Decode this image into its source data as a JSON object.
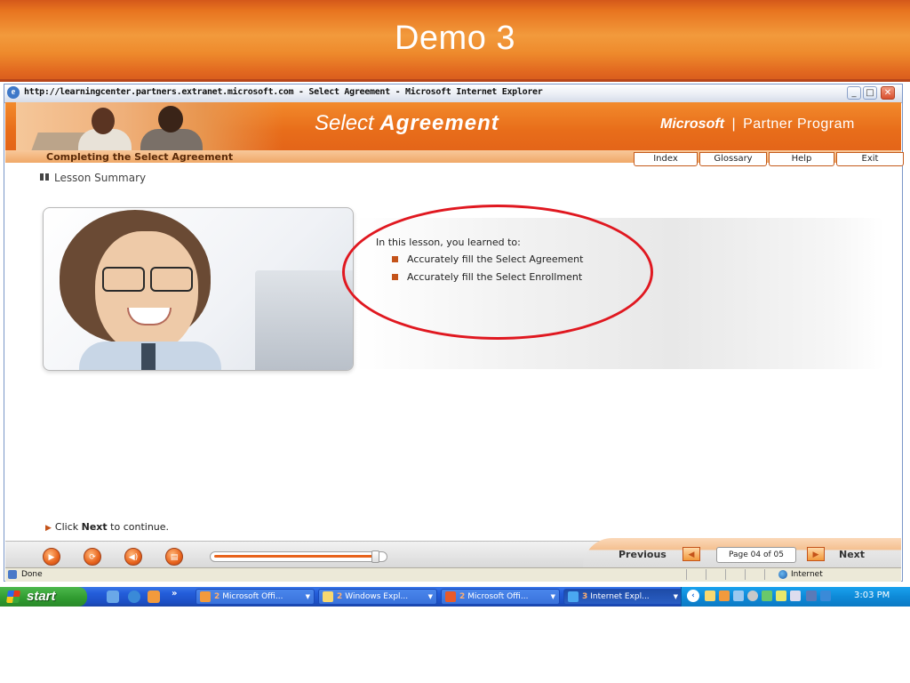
{
  "slide": {
    "title": "Demo 3"
  },
  "browser": {
    "title": "http://learningcenter.partners.extranet.microsoft.com - Select Agreement - Microsoft Internet Explorer",
    "status_text": "Done",
    "zone": "Internet"
  },
  "course": {
    "title_light": "Select",
    "title_bold": "Agreement",
    "brand_ms": "Microsoft",
    "brand_sep": "|",
    "brand_program": "Partner Program",
    "section": "Completing the Select Agreement",
    "nav": [
      "Index",
      "Glossary",
      "Help",
      "Exit"
    ],
    "lesson_heading": "Lesson Summary",
    "summary_intro": "In this lesson, you learned to:",
    "summary_items": [
      "Accurately fill the Select Agreement",
      "Accurately fill the Select Enrollment"
    ],
    "continue_pre": "Click",
    "continue_bold": "Next",
    "continue_post": "to continue."
  },
  "player": {
    "previous_label": "Previous",
    "next_label": "Next",
    "page_indicator": "Page 04 of 05",
    "progress_fraction": 0.95
  },
  "taskbar": {
    "start_label": "start",
    "quick_launch_chevron": "»",
    "tasks": [
      {
        "count": "2",
        "label": "Microsoft Offi...",
        "icon_color": "#f29a3c",
        "active": false
      },
      {
        "count": "2",
        "label": "Windows Expl...",
        "icon_color": "#f8d870",
        "active": false
      },
      {
        "count": "2",
        "label": "Microsoft Offi...",
        "icon_color": "#e85a2a",
        "active": false
      },
      {
        "count": "3",
        "label": "Internet Expl...",
        "icon_color": "#4aa8f0",
        "active": true
      }
    ],
    "clock": "3:03 PM"
  },
  "colors": {
    "accent": "#e8631c",
    "annotation": "#e01820",
    "taskbar": "#245edb"
  }
}
